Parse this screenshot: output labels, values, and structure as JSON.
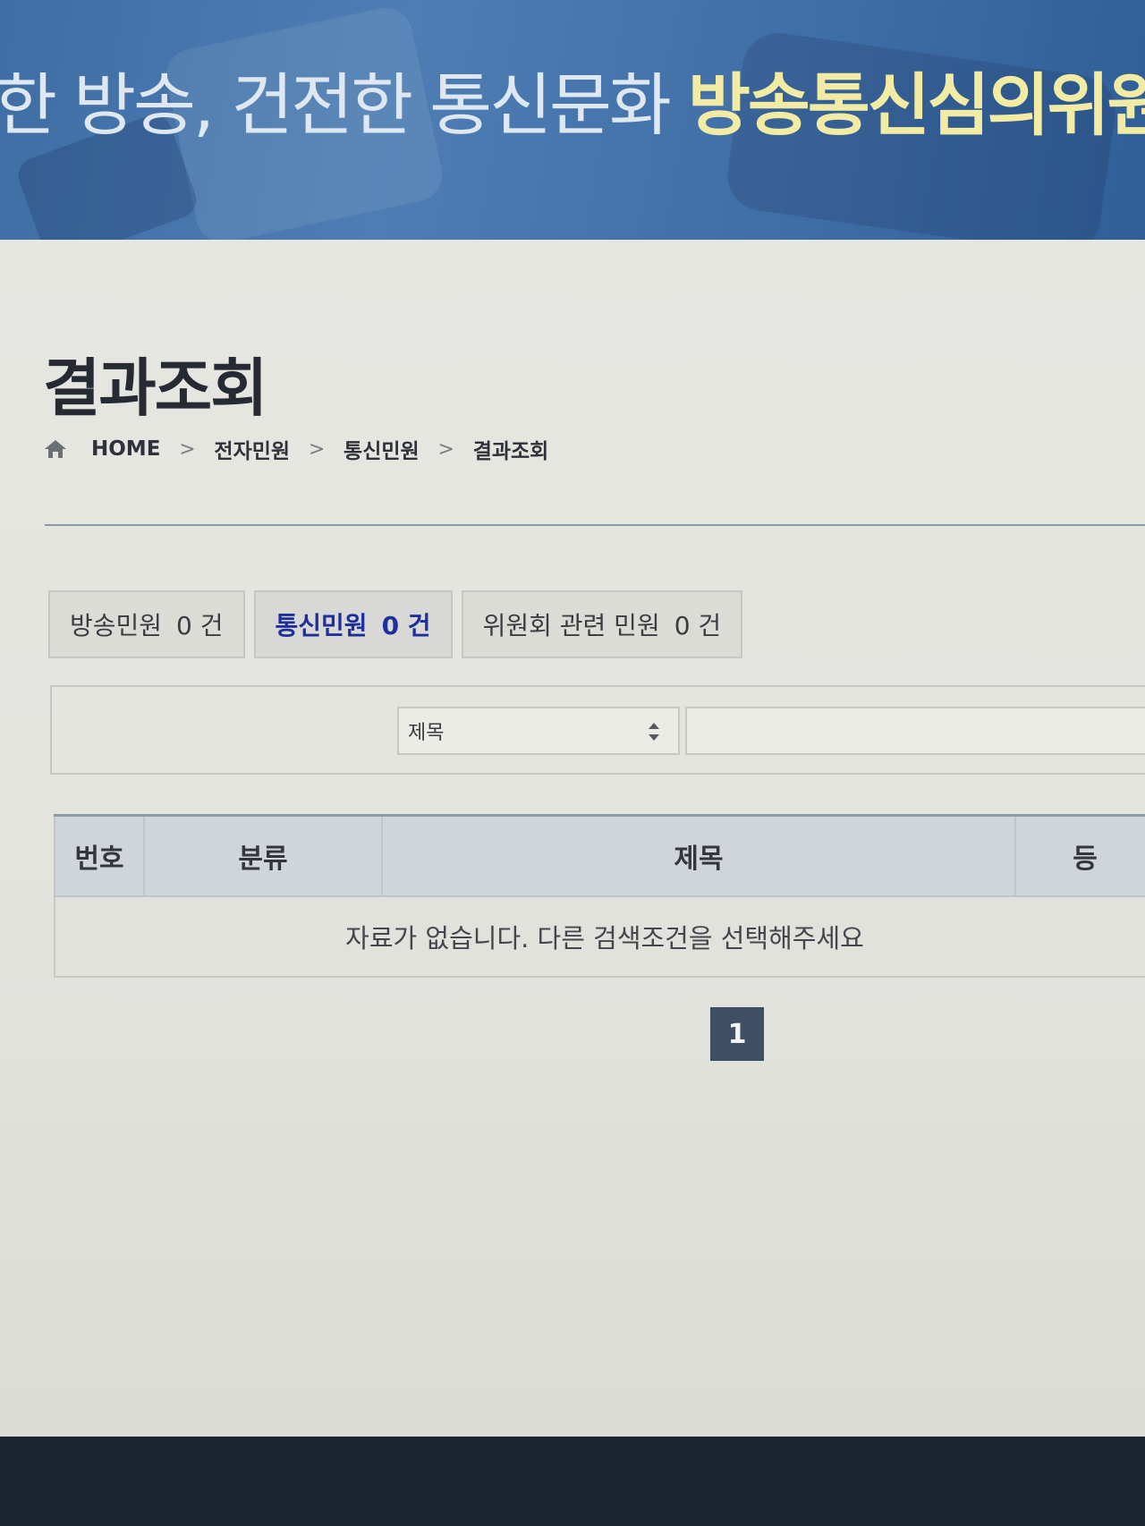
{
  "banner": {
    "slogan_prefix": "한 방송, 건전한 통신문화 ",
    "slogan_org": "방송통신심의위원회"
  },
  "page": {
    "title": "결과조회"
  },
  "breadcrumb": {
    "home": "HOME",
    "separator": ">",
    "items": [
      "전자민원",
      "통신민원",
      "결과조회"
    ]
  },
  "tabs": [
    {
      "label": "방송민원",
      "count": "0 건",
      "active": false
    },
    {
      "label": "통신민원",
      "count": "0 건",
      "active": true
    },
    {
      "label": "위원회 관련 민원",
      "count": "0 건",
      "active": false
    }
  ],
  "search": {
    "select_value": "제목",
    "input_value": ""
  },
  "table": {
    "columns": [
      "번호",
      "분류",
      "제목",
      "등"
    ],
    "empty_message": "자료가 없습니다. 다른 검색조건을 선택해주세요"
  },
  "pagination": {
    "current_page": "1"
  },
  "colors": {
    "banner_blue": "#4d7db3",
    "slogan_highlight": "#f1eba4",
    "active_tab_text": "#1e2f9c",
    "pagination_bg": "#3e4f63"
  }
}
